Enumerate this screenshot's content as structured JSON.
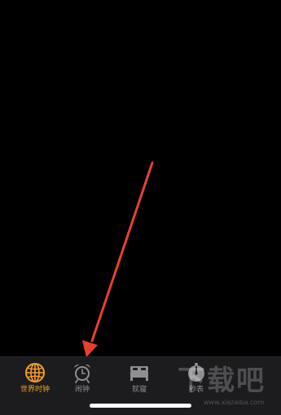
{
  "tab_bar": {
    "tabs": [
      {
        "label": "世界时钟",
        "icon": "globe-icon",
        "active": true
      },
      {
        "label": "闹钟",
        "icon": "alarm-clock-icon",
        "active": false
      },
      {
        "label": "就寝",
        "icon": "bed-icon",
        "active": false
      },
      {
        "label": "秒表",
        "icon": "stopwatch-icon",
        "active": false
      }
    ]
  },
  "colors": {
    "active": "#f7a01e",
    "inactive": "#8e8e93",
    "annotation_arrow": "#e8412b",
    "tab_bar_bg": "#1c1c1e"
  },
  "watermark": {
    "title": "下载吧",
    "url": "www.xiazaiba.com"
  }
}
